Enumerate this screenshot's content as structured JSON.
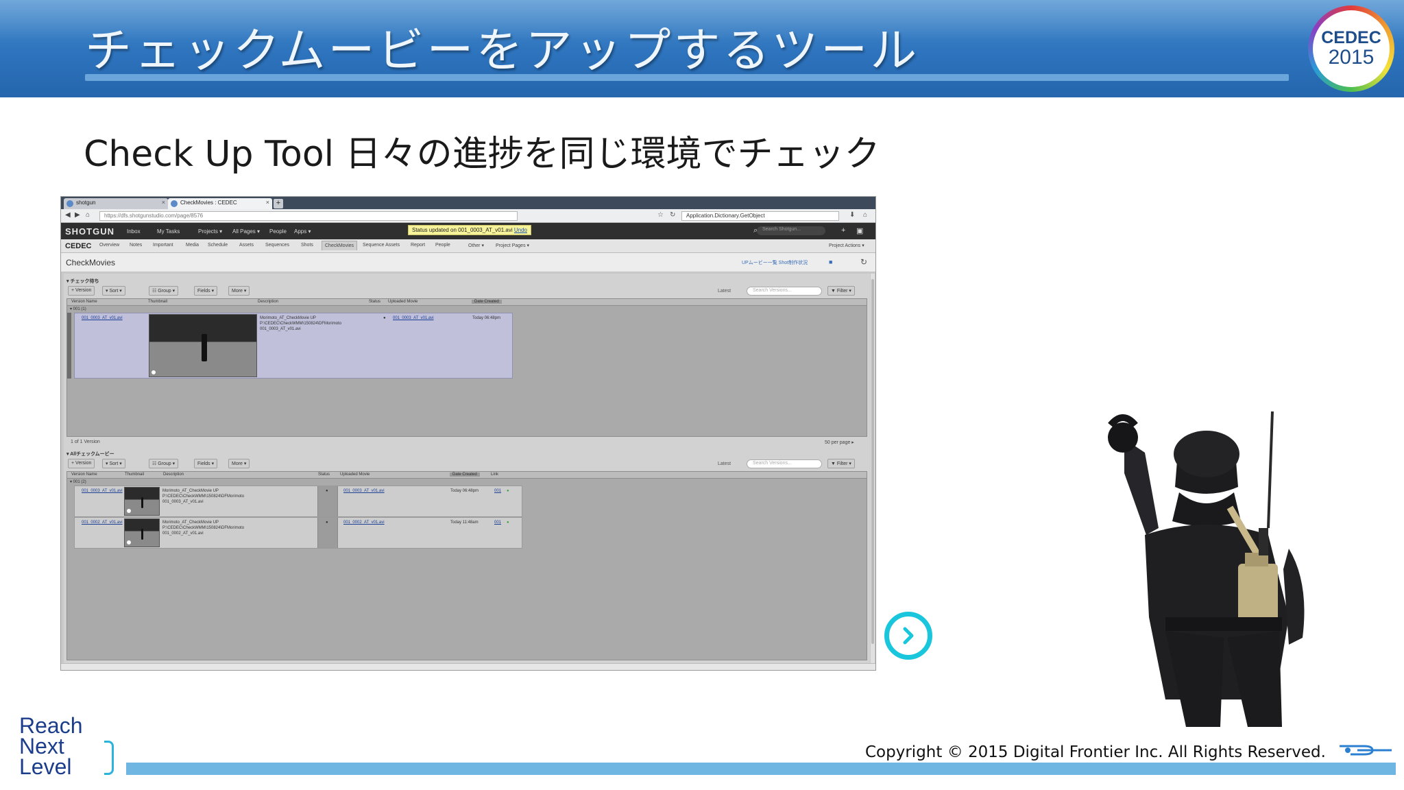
{
  "slide": {
    "title": "チェックムービーをアップするツール",
    "subtitle": "Check Up Tool 日々の進捗を同じ環境でチェック",
    "badge": {
      "line1": "CEDEC",
      "line2": "2015"
    },
    "copyright": "Copyright © 2015 Digital Frontier Inc. All Rights Reserved.",
    "logo": {
      "line1": "Reach",
      "line2": "Next",
      "line3": "Level"
    }
  },
  "browser": {
    "tabs": [
      {
        "label": "shotgun"
      },
      {
        "label": "CheckMovies : CEDEC"
      }
    ],
    "new_tab": "+",
    "url": "https://dfs.shotgunstudio.com/page/8576",
    "search_value": "Application.Dictionary.GetObject"
  },
  "shotgun": {
    "logo": "SHOTGUN",
    "nav": {
      "inbox": "Inbox",
      "my_tasks": "My Tasks",
      "projects": "Projects ▾",
      "all_pages": "All Pages ▾",
      "people": "People",
      "apps": "Apps ▾"
    },
    "status_message": "Status updated on 001_0003_AT_v01.avi",
    "status_undo": "Undo",
    "search_placeholder": "Search Shotgun...",
    "project": {
      "name": "CEDEC",
      "tabs": [
        "Overview",
        "Notes",
        "Important",
        "Media",
        "Schedule",
        "Assets",
        "Sequences",
        "Shots",
        "CheckMovies",
        "Sequence Assets",
        "Report",
        "People",
        "Other ▾",
        "Project Pages ▾"
      ],
      "selected_tab": "CheckMovies",
      "actions": "Project Actions ▾"
    },
    "page": {
      "title": "CheckMovies",
      "links": "UPムービー一覧    Shot制作状況"
    }
  },
  "section1": {
    "title": "▾ チェック待ち",
    "toolbar": {
      "version": "+ Version",
      "sort": "▾ Sort ▾",
      "group": "☷ Group ▾",
      "fields": "Fields ▾",
      "more": "More ▾",
      "latest": "Latest",
      "search_placeholder": "Search Versions...",
      "filter": "▼ Filter ▾"
    },
    "columns": [
      "Version Name",
      "Thumbnail",
      "Description",
      "Status",
      "Uploaded Movie",
      "Date Created"
    ],
    "group_label": "▾ 001 (1)",
    "rows": [
      {
        "version": "001_0003_AT_v01.avi",
        "desc_line1": "Morimoto_AT_CheckMovie UP",
        "desc_line2": "P:\\CEDEC\\CheckWMM\\150824\\DFMorimoto",
        "desc_line3": "001_0003_AT_v01.avi",
        "status": "●",
        "movie": "001_0003_AT_v01.avi",
        "date": "Today 06:48pm"
      }
    ],
    "footer_left": "1 of 1 Version",
    "footer_right": "50 per page ▸"
  },
  "section2": {
    "title": "▾ Allチェックムービー",
    "toolbar": {
      "version": "+ Version",
      "sort": "▾ Sort ▾",
      "group": "☷ Group ▾",
      "fields": "Fields ▾",
      "more": "More ▾",
      "latest": "Latest",
      "search_placeholder": "Search Versions...",
      "filter": "▼ Filter ▾"
    },
    "columns": [
      "Version Name",
      "Thumbnail",
      "Description",
      "Status",
      "Uploaded Movie",
      "Date Created",
      "Link"
    ],
    "group_label": "▾ 001 (2)",
    "rows": [
      {
        "version": "001_0003_AT_v01.avi",
        "desc_line1": "Morimoto_AT_CheckMovie UP",
        "desc_line2": "P:\\CEDEC\\CheckWMM\\150824\\DFMorimoto",
        "desc_line3": "001_0003_AT_v01.avi",
        "status": "●",
        "movie": "001_0003_AT_v01.avi",
        "date": "Today 06:48pm",
        "link": "001"
      },
      {
        "version": "001_0002_AT_v01.avi",
        "desc_line1": "Morimoto_AT_CheckMovie UP",
        "desc_line2": "P:\\CEDEC\\CheckWMM\\150824\\DFMorimoto",
        "desc_line3": "001_0002_AT_v01.avi",
        "status": "●",
        "movie": "001_0002_AT_v01.avi",
        "date": "Today 11:48am",
        "link": "001"
      }
    ]
  },
  "colors": {
    "header_blue": "#2d73bd",
    "accent_cyan": "#19c6dc",
    "row_highlight": "#c0c0da",
    "shotgun_bar": "#2f2f2f"
  },
  "icons": {
    "next": "chevron-right-icon",
    "refresh": "refresh-icon",
    "add": "plus-icon"
  }
}
